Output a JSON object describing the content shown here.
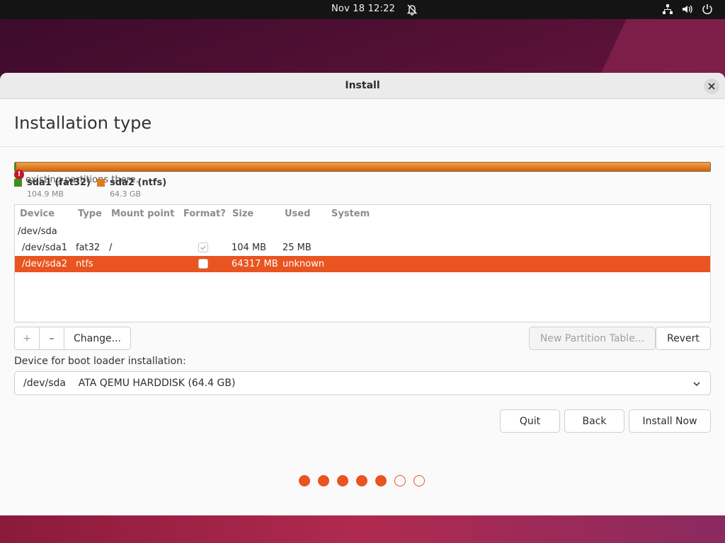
{
  "system_bar": {
    "clock": "Nov 18  12:22",
    "icons": [
      "bell-off-icon",
      "network-icon",
      "volume-icon",
      "power-icon"
    ]
  },
  "window": {
    "title": "Install",
    "close_icon": "close-icon"
  },
  "page": {
    "title": "Installation type"
  },
  "partition_bar": {
    "warning_text": "existing partitions there.",
    "legend": [
      {
        "name": "sda1 (fat32)",
        "size": "104.9 MB",
        "color": "#3b8f1d"
      },
      {
        "name": "sda2 (ntfs)",
        "size": "64.3 GB",
        "color": "#e07b1e"
      }
    ]
  },
  "table": {
    "headers": {
      "device": "Device",
      "type": "Type",
      "mount": "Mount point",
      "format": "Format?",
      "size": "Size",
      "used": "Used",
      "system": "System"
    },
    "rows": [
      {
        "device": "/dev/sda",
        "type": "",
        "mount": "",
        "format": null,
        "size": "",
        "used": "",
        "system": ""
      },
      {
        "device": "/dev/sda1",
        "type": "fat32",
        "mount": "/",
        "format": true,
        "size": "104 MB",
        "used": "25 MB",
        "system": ""
      },
      {
        "device": "/dev/sda2",
        "type": "ntfs",
        "mount": "",
        "format": false,
        "size": "64317 MB",
        "used": "unknown",
        "system": ""
      }
    ],
    "selected_row": 2
  },
  "partition_actions": {
    "add_label": "+",
    "remove_label": "–",
    "change_label": "Change...",
    "new_table_label": "New Partition Table...",
    "revert_label": "Revert"
  },
  "bootloader": {
    "label": "Device for boot loader installation:",
    "selected": "/dev/sda    ATA QEMU HARDDISK (64.4 GB)"
  },
  "nav": {
    "quit_label": "Quit",
    "back_label": "Back",
    "install_label": "Install Now"
  },
  "progress": {
    "total_steps": 7,
    "completed_steps": 5
  },
  "colors": {
    "accent": "#e95420",
    "warning": "#c7162b"
  }
}
